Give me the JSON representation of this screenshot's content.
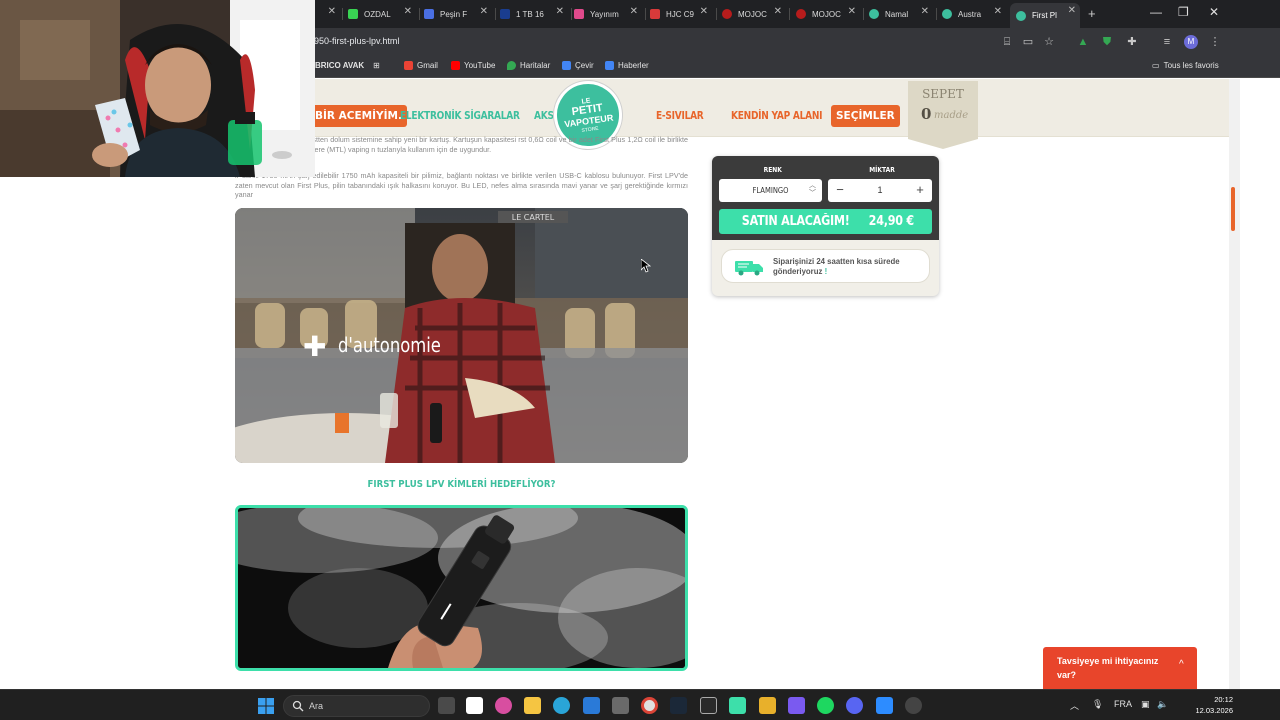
{
  "browser": {
    "tabs": [
      {
        "label": "",
        "active": false
      },
      {
        "label": "OZDAL",
        "active": false,
        "color": "#39d353"
      },
      {
        "label": "Peşin F",
        "active": false,
        "color": "#4a6fe3"
      },
      {
        "label": "1 TB 16",
        "active": false,
        "color": "#1a3d8f"
      },
      {
        "label": "Yayınım",
        "active": false,
        "color": "#e04a8c"
      },
      {
        "label": "HJC C9",
        "active": false,
        "color": "#d83a3a"
      },
      {
        "label": "MOJOC",
        "active": false,
        "color": "#b71c1c"
      },
      {
        "label": "MOJOC",
        "active": false,
        "color": "#b71c1c"
      },
      {
        "label": "Namal",
        "active": false,
        "color": "#3dbf9e"
      },
      {
        "label": "Austra",
        "active": false,
        "color": "#3dbf9e"
      },
      {
        "label": "First Pl",
        "active": true,
        "color": "#3dbf9e"
      }
    ],
    "new_tab": "+",
    "window_controls": {
      "minimize": "—",
      "restore": "❐",
      "close": "✕"
    },
    "url": "950-first-plus-lpv.html",
    "avatar_letter": "M",
    "bookmarks": [
      {
        "label": "BRICO AVAK",
        "icon_color": ""
      },
      {
        "label": "Gmail",
        "icon_color": "#ea4335"
      },
      {
        "label": "YouTube",
        "icon_color": "#ff0000"
      },
      {
        "label": "Haritalar",
        "icon_color": "#34a853"
      },
      {
        "label": "Çevir",
        "icon_color": "#4285f4"
      },
      {
        "label": "Haberler",
        "icon_color": "#4285f4"
      }
    ],
    "all_bookmarks": "Tous les favoris"
  },
  "site": {
    "nav": {
      "items": [
        "BİR ACEMİYİM.",
        "ELEKTRONİK SİGARALAR",
        "AKS",
        "E-SIVILAR",
        "KENDİN YAP ALANI",
        "SEÇİMLER"
      ],
      "logo": {
        "line1": "LE",
        "line2": "PETIT",
        "line3": "VAPOTEUR",
        "line4": "STORE"
      }
    },
    "cart": {
      "title": "SEPET",
      "count": "0",
      "unit": "madde"
    },
    "desc1": "eşli ve hızlı kaydırmalı üstten dolum sistemine sahip yeni bir kartuş. Kartuşun kapasitesi rst 0,6Ω coil ve bir adet First Plus 1,2Ω coil ile birlikte gelir. İkincisi, ağızdan ciğere (MTL) vaping n tuzlarıyla kullanım için de uygundur.",
    "desc2": "ir dahili 1750 mAh şarj edilebilir 1750 mAh kapasiteli bir pilimiz, bağlantı noktası ve birlikte verilen USB-C kablosu bulunuyor. First LPV'de zaten mevcut olan First Plus, pilin tabanındaki ışık halkasını koruyor. Bu LED, nefes alma sırasında mavi yanar ve şarj gerektiğinde kırmızı yanar",
    "video1_overlay": "d'autonomie",
    "video1_sign": "LE CARTEL",
    "section_title": "FIRST PLUS LPV KİMLERİ HEDEFLİYOR?",
    "buybox": {
      "color_label": "RENK",
      "qty_label": "MİKTAR",
      "color_value": "FLAMINGO",
      "qty_value": "1",
      "minus": "−",
      "plus": "+",
      "buy_label": "SATIN ALACAĞIM!",
      "price": "24,90 €",
      "shipping": "Siparişinizi 24 saatten kısa sürede gönderiyoruz",
      "shipping_excl": "!"
    },
    "chat": {
      "text": "Tavsiyeye mi ihtiyacınız var?",
      "chevron": "^"
    }
  },
  "taskbar": {
    "search_placeholder": "Ara",
    "lang": "FRA",
    "time": "20:12",
    "date": "12.03.2026"
  },
  "colors": {
    "accent_green": "#3dbf9e",
    "accent_orange": "#e8652b",
    "buy_green": "#3ddfaa",
    "chat_red": "#e8452b"
  }
}
